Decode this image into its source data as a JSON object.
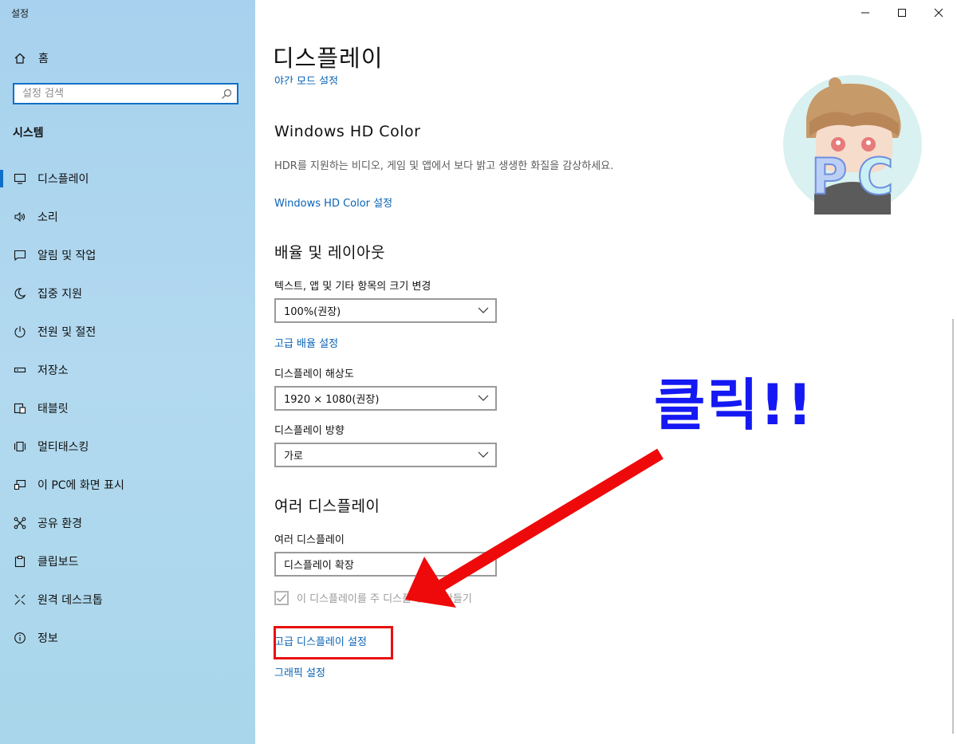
{
  "app": {
    "title": "설정"
  },
  "sidebar": {
    "home_label": "홈",
    "search_placeholder": "설정 검색",
    "section_label": "시스템",
    "items": [
      {
        "label": "디스플레이",
        "icon": "monitor-icon",
        "active": true
      },
      {
        "label": "소리",
        "icon": "speaker-icon"
      },
      {
        "label": "알림 및 작업",
        "icon": "notification-icon"
      },
      {
        "label": "집중 지원",
        "icon": "moon-icon"
      },
      {
        "label": "전원 및 절전",
        "icon": "power-icon"
      },
      {
        "label": "저장소",
        "icon": "storage-icon"
      },
      {
        "label": "태블릿",
        "icon": "tablet-icon"
      },
      {
        "label": "멀티태스킹",
        "icon": "multitasking-icon"
      },
      {
        "label": "이 PC에 화면 표시",
        "icon": "projecting-icon"
      },
      {
        "label": "공유 환경",
        "icon": "shared-experiences-icon"
      },
      {
        "label": "클립보드",
        "icon": "clipboard-icon"
      },
      {
        "label": "원격 데스크톱",
        "icon": "remote-desktop-icon"
      },
      {
        "label": "정보",
        "icon": "info-icon"
      }
    ]
  },
  "main": {
    "title": "디스플레이",
    "night_link": "야간 모드 설정",
    "hdr": {
      "heading": "Windows HD Color",
      "description": "HDR를 지원하는 비디오, 게임 및 앱에서 보다 밝고 생생한 화질을 감상하세요.",
      "link": "Windows HD Color 설정"
    },
    "scale": {
      "heading": "배율 및 레이아웃",
      "text_label": "텍스트, 앱 및 기타 항목의 크기 변경",
      "text_value": "100%(권장)",
      "advanced_link": "고급 배율 설정",
      "resolution_label": "디스플레이 해상도",
      "resolution_value": "1920 × 1080(권장)",
      "orientation_label": "디스플레이 방향",
      "orientation_value": "가로"
    },
    "multi": {
      "heading": "여러 디스플레이",
      "label": "여러 디스플레이",
      "value": "디스플레이 확장",
      "checkbox_label": "이 디스플레이를 주 디스플레이로 만들기",
      "checkbox_checked": true,
      "advanced_display_link": "고급 디스플레이 설정",
      "graphics_link": "그래픽 설정"
    }
  },
  "annotation": {
    "callout": "클릭!!",
    "callout_color": "#1418f2",
    "arrow_color": "#ee0a0a",
    "highlight_color": "#e81010"
  },
  "window_controls": [
    "minimize-icon",
    "maximize-icon",
    "close-icon"
  ],
  "colors": {
    "accent": "#0f6fc6",
    "link": "#0a63b5"
  }
}
